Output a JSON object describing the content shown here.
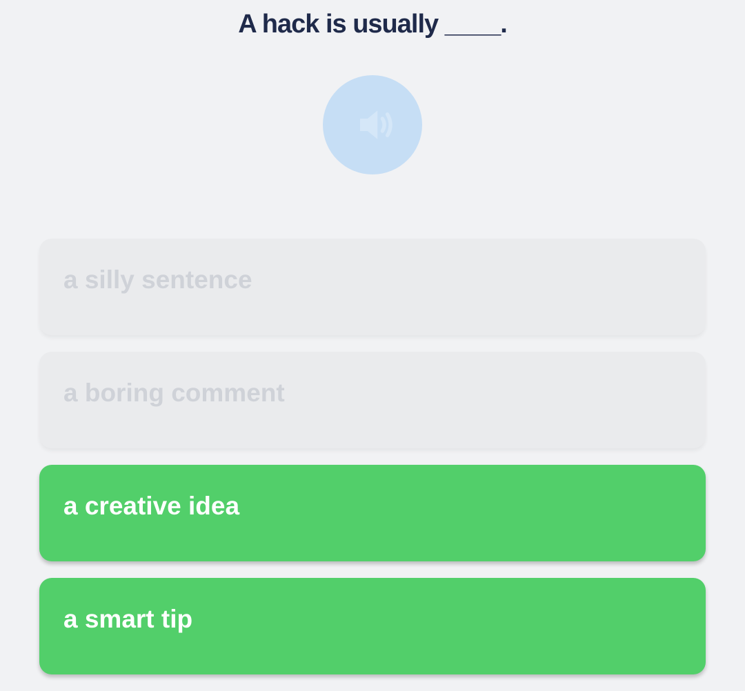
{
  "question": {
    "text": "A hack is usually ____."
  },
  "audio_button": {
    "icon": "speaker-icon",
    "color": "#c6def5"
  },
  "options": [
    {
      "label": "a silly sentence",
      "state": "faded"
    },
    {
      "label": "a boring comment",
      "state": "faded"
    },
    {
      "label": "a creative idea",
      "state": "correct"
    },
    {
      "label": "a smart tip",
      "state": "correct"
    }
  ],
  "colors": {
    "background": "#f1f2f4",
    "question_text": "#1f2a4a",
    "correct": "#52cf6a",
    "faded_bg": "#eaebed",
    "faded_text": "#cfd2d8"
  }
}
